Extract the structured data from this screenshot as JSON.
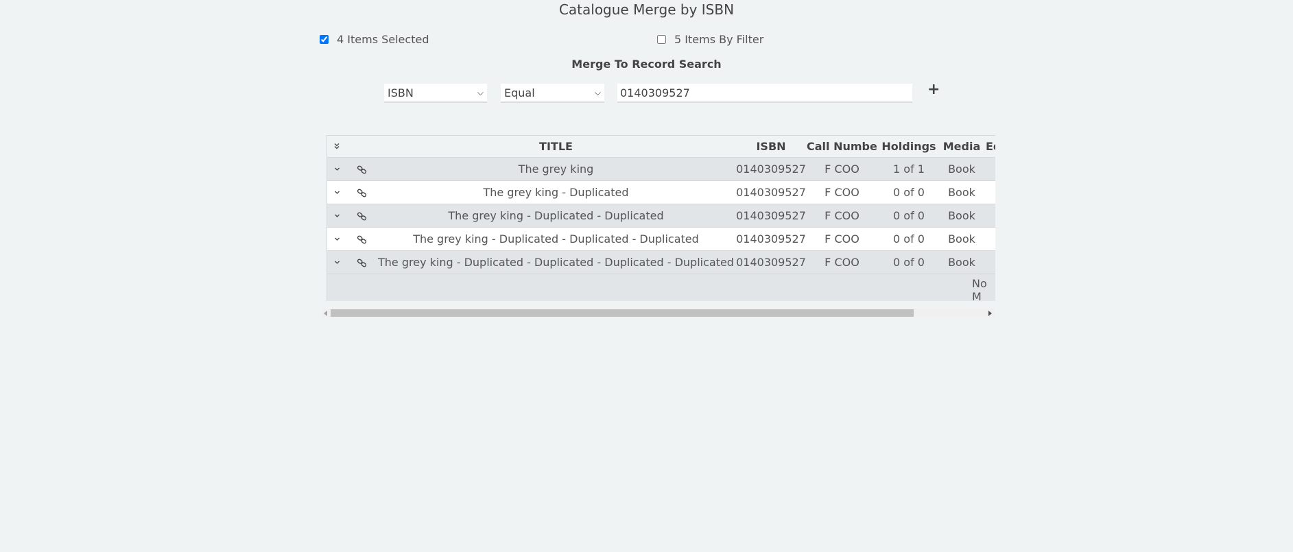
{
  "page": {
    "title": "Catalogue Merge by ISBN",
    "subtitle": "Merge To Record Search"
  },
  "selection": {
    "items_selected_label": "4 Items Selected",
    "items_selected_checked": true,
    "items_by_filter_label": "5 Items By Filter",
    "items_by_filter_checked": false
  },
  "search": {
    "field_value": "ISBN",
    "operator_value": "Equal",
    "query_value": "0140309527",
    "add_icon": "plus-icon"
  },
  "table": {
    "headers": {
      "expand_all_icon": "double-chevron-down-icon",
      "title": "TITLE",
      "isbn": "ISBN",
      "call_number": "Call Number",
      "holdings": "Holdings",
      "media": "Media",
      "edition": "Edi"
    },
    "rows": [
      {
        "title": "The grey king",
        "isbn": "0140309527",
        "call_number": "F COO",
        "holdings": "1 of 1",
        "media": "Book"
      },
      {
        "title": "The grey king - Duplicated",
        "isbn": "0140309527",
        "call_number": "F COO",
        "holdings": "0 of 0",
        "media": "Book"
      },
      {
        "title": "The grey king - Duplicated - Duplicated",
        "isbn": "0140309527",
        "call_number": "F COO",
        "holdings": "0 of 0",
        "media": "Book"
      },
      {
        "title": "The grey king - Duplicated - Duplicated - Duplicated",
        "isbn": "0140309527",
        "call_number": "F COO",
        "holdings": "0 of 0",
        "media": "Book"
      },
      {
        "title": "The grey king - Duplicated - Duplicated - Duplicated - Duplicated",
        "isbn": "0140309527",
        "call_number": "F COO",
        "holdings": "0 of 0",
        "media": "Book"
      }
    ],
    "footer_text": "No M",
    "row_expand_icon": "chevron-down-icon",
    "row_link_icon": "link-icon"
  },
  "colors": {
    "background": "#f0f3f4",
    "row_alt": "#e1e5e7",
    "checkbox_accent": "#1a73e8"
  }
}
